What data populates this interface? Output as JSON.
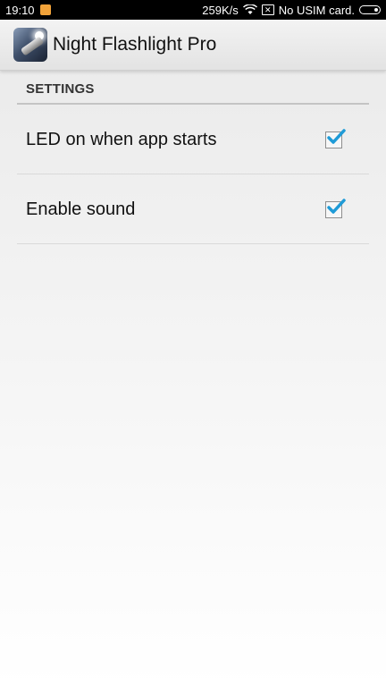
{
  "status_bar": {
    "time": "19:10",
    "net_speed": "259K/s",
    "carrier": "No USIM card.",
    "icons": [
      "notification-icon",
      "wifi-icon",
      "sim-missing-icon",
      "battery-icon"
    ],
    "sim_icon_glyph": "✕"
  },
  "action_bar": {
    "app_icon": "flashlight-app-icon",
    "title": "Night Flashlight Pro"
  },
  "settings": {
    "section_title": "SETTINGS",
    "items": [
      {
        "label": "LED on when app starts",
        "checked": true
      },
      {
        "label": "Enable sound",
        "checked": true
      }
    ]
  },
  "colors": {
    "checkmark": "#1f9bd7",
    "status_bar_bg": "#000000",
    "notification": "#f2a33a"
  }
}
